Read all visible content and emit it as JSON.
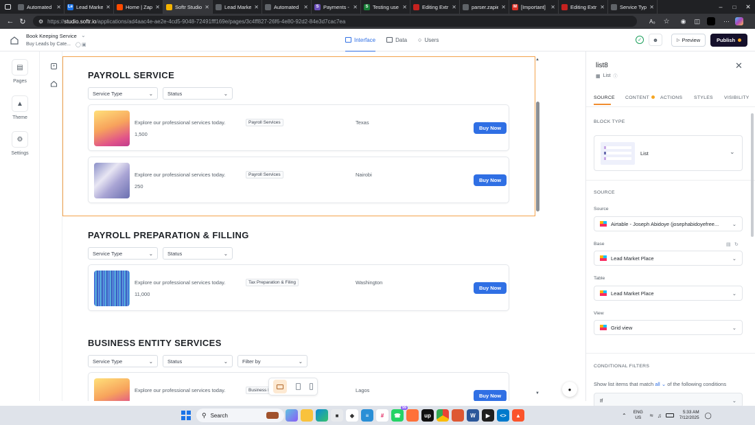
{
  "browser": {
    "tabs": [
      {
        "title": "Automated",
        "color": "#5f6368"
      },
      {
        "title": "Lead Market",
        "color": "#1a73e8",
        "letter": "Le"
      },
      {
        "title": "Home | Zap",
        "color": "#ff4a00"
      },
      {
        "title": "Softr Studio",
        "color": "#f4b400",
        "active": true
      },
      {
        "title": "Lead Market",
        "color": "#5f6368"
      },
      {
        "title": "Automated",
        "color": "#5f6368"
      },
      {
        "title": "Payments -",
        "color": "#6b4fbb",
        "letter": "S"
      },
      {
        "title": "Testing use",
        "color": "#188038",
        "letter": "S"
      },
      {
        "title": "Editing Extr",
        "color": "#c5221f"
      },
      {
        "title": "parser.zapie",
        "color": "#5f6368"
      },
      {
        "title": "[Important]",
        "color": "#d93025",
        "letter": "M"
      },
      {
        "title": "Editing Extr",
        "color": "#c5221f"
      },
      {
        "title": "Service Type",
        "color": "#5f6368"
      }
    ],
    "url_prefix": "https://",
    "url_host": "studio.softr.io",
    "url_path": "/applications/ad4aac4e-ae2e-4cd5-9048-72491fff169e/pages/3c4ff827-26f6-4e80-92d2-84e3d7cac7ea"
  },
  "header": {
    "app_name": "Book Keeping Service",
    "page_name": "Buy Leads by Cate...",
    "tabs": [
      {
        "label": "Interface",
        "active": true
      },
      {
        "label": "Data"
      },
      {
        "label": "Users"
      }
    ],
    "preview_label": "Preview",
    "publish_label": "Publish"
  },
  "rail": {
    "items": [
      {
        "label": "Pages",
        "icon": "pages-icon"
      },
      {
        "label": "Theme",
        "icon": "theme-icon"
      },
      {
        "label": "Settings",
        "icon": "settings-icon"
      }
    ]
  },
  "canvas": {
    "sections": [
      {
        "title": "PAYROLL SERVICE",
        "filters": [
          "Service Type",
          "Status"
        ],
        "items": [
          {
            "desc": "Explore our professional services today.",
            "price": "1,500",
            "tag": "Payroll Services",
            "location": "Texas",
            "button": "Buy Now",
            "thumb": "warm"
          },
          {
            "desc": "Explore our professional services today.",
            "price": "250",
            "tag": "Payroll Services",
            "location": "Nairobi",
            "button": "Buy Now",
            "thumb": "silver"
          }
        ]
      },
      {
        "title": "PAYROLL PREPARATION & FILLING",
        "filters": [
          "Service Type",
          "Status"
        ],
        "items": [
          {
            "desc": "Explore our professional services today.",
            "price": "11,000",
            "tag": "Tax Preparation & Filing",
            "location": "Washington",
            "button": "Buy Now",
            "thumb": "blue"
          }
        ]
      },
      {
        "title": "BUSINESS ENTITY SERVICES",
        "filters": [
          "Service Type",
          "Status",
          "Filter by"
        ],
        "items": [
          {
            "desc": "Explore our professional services today.",
            "price": "",
            "tag": "Business E",
            "location": "Lagos",
            "button": "Buy Now",
            "thumb": "warm"
          }
        ]
      }
    ]
  },
  "panel": {
    "block_name": "list8",
    "block_type_small": "List",
    "tabs": [
      "SOURCE",
      "CONTENT",
      "ACTIONS",
      "STYLES",
      "VISIBILITY"
    ],
    "block_type_heading": "BLOCK TYPE",
    "block_type_value": "List",
    "source_heading": "SOURCE",
    "source_label": "Source",
    "source_value": "Airtable - Joseph Abidoye (josephabidoyefree...",
    "base_label": "Base",
    "base_value": "Lead Market Place",
    "table_label": "Table",
    "table_value": "Lead Market Place",
    "view_label": "View",
    "view_value": "Grid view",
    "cond_heading": "CONDITIONAL FILTERS",
    "cond_text_1": "Show list items that match",
    "cond_link": "all",
    "cond_text_2": "of the following conditions",
    "cond_if": "If"
  },
  "taskbar": {
    "search_label": "Search",
    "lang": "ENG",
    "region": "US",
    "time": "5:33 AM",
    "date": "7/12/2025",
    "badge": "99"
  }
}
